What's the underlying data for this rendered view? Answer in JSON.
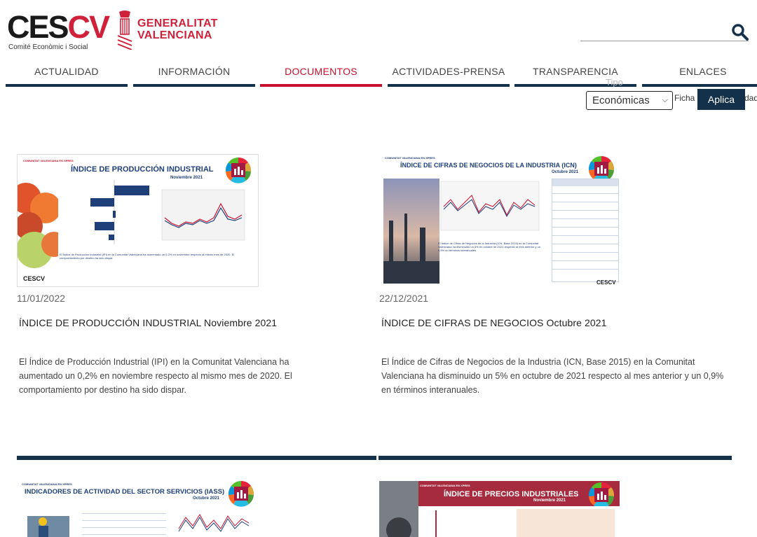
{
  "header": {
    "logo_main_dark": "CES",
    "logo_main_red": "CV",
    "logo_subtitle": "Comité Econòmic i Social",
    "gv_line1": "GENERALITAT",
    "gv_line2": "VALENCIANA"
  },
  "nav": {
    "items": [
      {
        "label": "ACTUALIDAD"
      },
      {
        "label": "INFORMACIÓN"
      },
      {
        "label": "DOCUMENTOS"
      },
      {
        "label": "ACTIVIDADES-PRENSA"
      },
      {
        "label": "TRANSPARENCIA"
      },
      {
        "label": "ENLACES"
      }
    ],
    "active": "DOCUMENTOS"
  },
  "filter": {
    "caption": "Tipo",
    "selected": "Económicas",
    "ficha_label": "Ficha",
    "trailing_label": "dad",
    "apply_label": "Aplica"
  },
  "cards": [
    {
      "date": "11/01/2022",
      "title": "ÍNDICE DE PRODUCCIÓN INDUSTRIAL Noviembre 2021",
      "description": "El Índice de Producción Industrial (IPI) en la Comunitat Valenciana ha aumentado un 0,2% en noviembre respecto al mismo mes de 2020. El comportamiento por destino ha sido dispar.",
      "thumb_tag": "COMUNITAT VALENCIANA EN XPRES",
      "thumb_title": "ÍNDICE DE PRODUCCIÓN INDUSTRIAL",
      "thumb_subtitle": "Noviembre 2021",
      "thumb_logo": "CESCV"
    },
    {
      "date": "22/12/2021",
      "title": "ÍNDICE DE CIFRAS DE NEGOCIOS Octubre 2021",
      "description": "El Índice de Cifras de Negocios de la Industria (ICN, Base 2015) en la Comunitat Valenciana ha disminuido un 5% en octubre de 2021 respecto al mes anterior y un 0,9% en términos interanuales.",
      "thumb_tag": "COMUNITAT VALENCIANA EN XPRES",
      "thumb_title": "ÍNDICE DE CIFRAS DE NEGOCIOS DE LA INDUSTRIA (ICN)",
      "thumb_subtitle": "Octubre 2021",
      "thumb_logo": "CESCV"
    },
    {
      "thumb_tag": "COMUNITAT VALENCIANA EN XPRES",
      "thumb_title": "INDICADORES DE ACTIVIDAD DEL SECTOR SERVICIOS (IASS)",
      "thumb_subtitle": "Octubre 2021"
    },
    {
      "thumb_tag": "COMUNITAT VALENCIANA EN XPRES",
      "thumb_title": "ÍNDICE DE PRECIOS INDUSTRIALES",
      "thumb_subtitle": "Noviembre 2021"
    }
  ],
  "colors": {
    "navy": "#13314a",
    "accent_red": "#c8102e"
  },
  "icons": [
    "search-icon",
    "chevron-down-icon",
    "sdg-icon",
    "crest-icon"
  ]
}
